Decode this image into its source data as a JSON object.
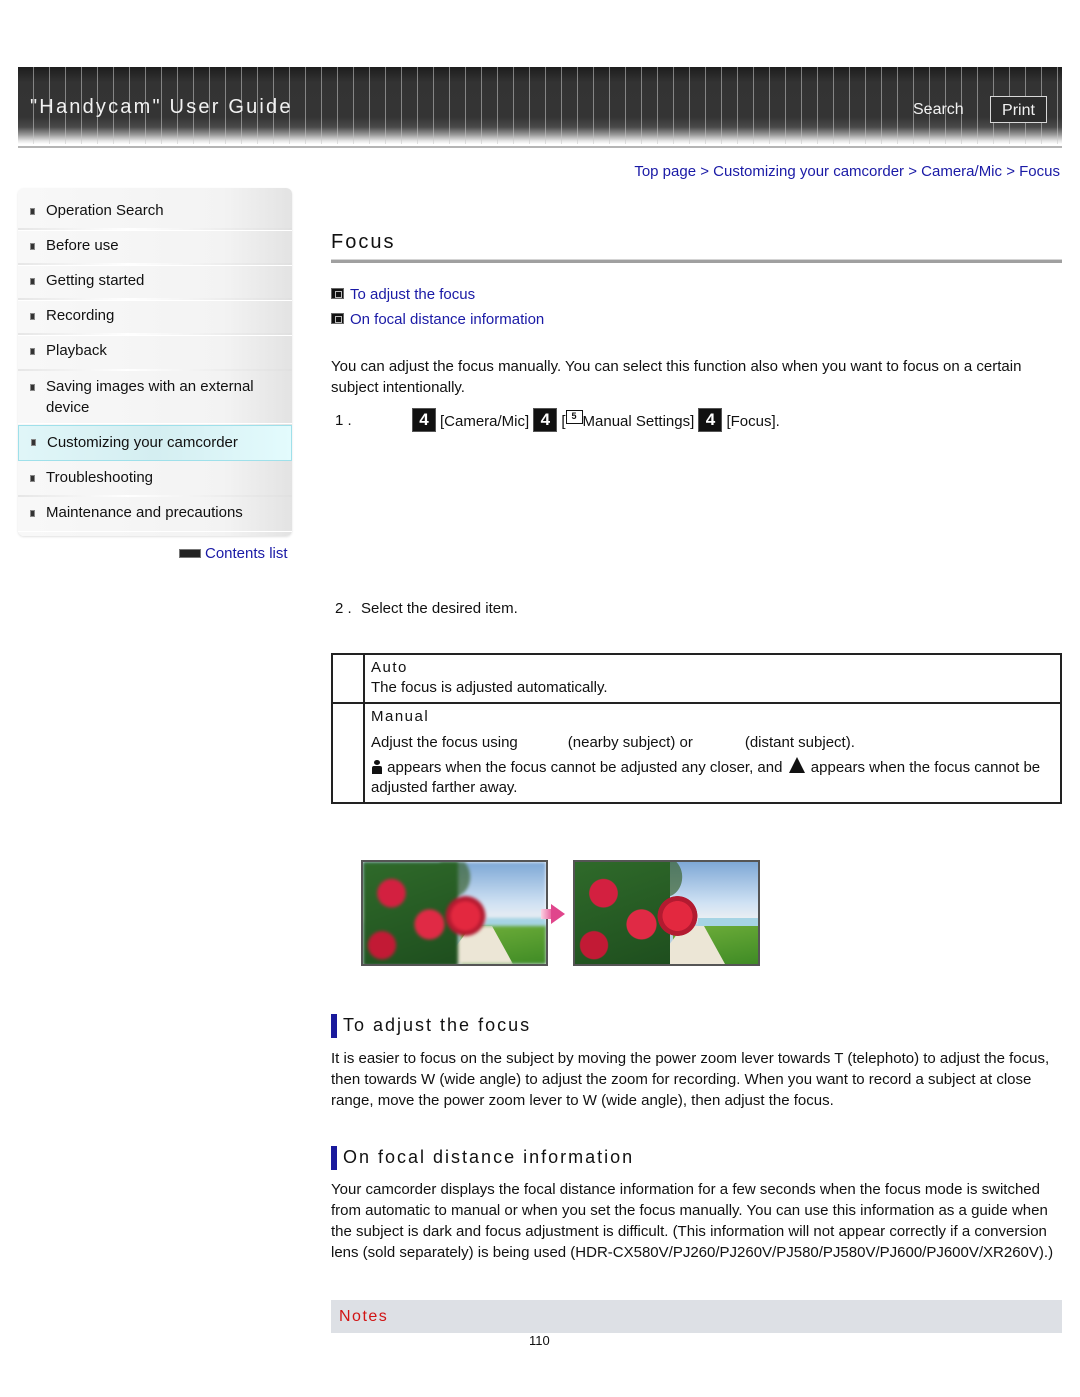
{
  "header": {
    "app_title": "\"Handycam\" User Guide",
    "search_label": "Search",
    "print_label": "Print"
  },
  "breadcrumb": {
    "items": [
      "Top page",
      "Customizing your camcorder",
      "Camera/Mic",
      "Focus"
    ],
    "separator": ">"
  },
  "sidebar": {
    "items": [
      {
        "label": "Operation Search",
        "active": false
      },
      {
        "label": "Before use",
        "active": false
      },
      {
        "label": "Getting started",
        "active": false
      },
      {
        "label": "Recording",
        "active": false
      },
      {
        "label": "Playback",
        "active": false
      },
      {
        "label": "Saving images with an external device",
        "active": false
      },
      {
        "label": "Customizing your camcorder",
        "active": true
      },
      {
        "label": "Troubleshooting",
        "active": false
      },
      {
        "label": "Maintenance and precautions",
        "active": false
      }
    ],
    "contents_list_label": "Contents list"
  },
  "main": {
    "title": "Focus",
    "toc": [
      {
        "label": "To adjust the focus",
        "icon": "section-link-icon"
      },
      {
        "label": "On focal distance information",
        "icon": "section-link-icon"
      }
    ],
    "intro": "You can adjust the focus manually. You can select this function also when you want to focus on a certain subject intentionally.",
    "step1": {
      "number": "1 .",
      "icon_glyph": "4",
      "part1": "[Camera/Mic]",
      "part2_open": "[",
      "mini_icon_glyph": "5",
      "part2": "Manual Settings]",
      "part3": "[Focus]."
    },
    "step2": {
      "number": "2 .",
      "text": "Select the desired item."
    },
    "options": [
      {
        "name": "Auto",
        "description": "The focus is adjusted automatically."
      },
      {
        "name": "Manual",
        "line1_a": "Adjust the focus using",
        "line1_b": "(nearby subject) or",
        "line1_c": "(distant subject).",
        "line2_a": "appears when the focus cannot be adjusted any closer, and",
        "line2_b": "appears when the focus cannot be adjusted farther away."
      }
    ],
    "images": [
      {
        "label": "out-of-focus-example"
      },
      {
        "label": "in-focus-example"
      }
    ],
    "sections": [
      {
        "heading": "To adjust the focus",
        "body": "It is easier to focus on the subject by moving the power zoom lever towards T (telephoto) to adjust the focus, then towards W (wide angle) to adjust the zoom for recording. When you want to record a subject at close range, move the power zoom lever to W (wide angle), then adjust the focus."
      },
      {
        "heading": "On focal distance information",
        "body": "Your camcorder displays the focal distance information for a few seconds when the focus mode is switched from automatic to manual or when you set the focus manually. You can use this information as a guide when the subject is dark and focus adjustment is difficult. (This information will not appear correctly if a conversion lens (sold separately) is being used (HDR-CX580V/PJ260/PJ260V/PJ580/PJ580V/PJ600/PJ600V/XR260V).)"
      }
    ],
    "notes_label": "Notes",
    "page_number": "110"
  },
  "colors": {
    "link": "#1a1aa6",
    "section_bar": "#1a1a9c",
    "notes_text": "#d11414",
    "notes_bg": "#dde0e5",
    "active_nav_bg": "#d4eef1"
  }
}
